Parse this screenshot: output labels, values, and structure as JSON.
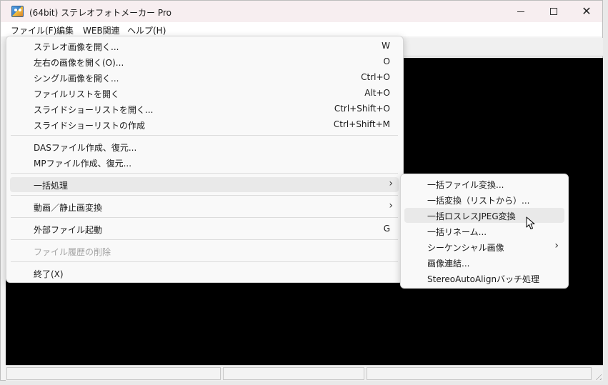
{
  "window": {
    "title": "(64bit) ステレオフォトメーカー Pro"
  },
  "menubar": {
    "items": [
      {
        "label": "ファイル(F)"
      },
      {
        "label": "編集"
      },
      {
        "label": "WEB関連"
      },
      {
        "label": "ヘルプ(H)"
      }
    ]
  },
  "file_menu": {
    "items": [
      {
        "label": "ステレオ画像を開く...",
        "shortcut": "W"
      },
      {
        "label": "左右の画像を開く(O)...",
        "shortcut": "O"
      },
      {
        "label": "シングル画像を開く...",
        "shortcut": "Ctrl+O"
      },
      {
        "label": "ファイルリストを開く",
        "shortcut": "Alt+O"
      },
      {
        "label": "スライドショーリストを開く...",
        "shortcut": "Ctrl+Shift+O"
      },
      {
        "label": "スライドショーリストの作成",
        "shortcut": "Ctrl+Shift+M"
      },
      {
        "label": "DASファイル作成、復元..."
      },
      {
        "label": "MPファイル作成、復元..."
      },
      {
        "label": "一括処理",
        "submenu": true,
        "highlighted": true
      },
      {
        "label": "動画／静止画変換",
        "submenu": true
      },
      {
        "label": "外部ファイル起動",
        "shortcut": "G"
      },
      {
        "label": "ファイル履歴の削除",
        "disabled": true
      },
      {
        "label": "終了(X)"
      }
    ]
  },
  "batch_submenu": {
    "items": [
      {
        "label": "一括ファイル変換..."
      },
      {
        "label": "一括変換（リストから）..."
      },
      {
        "label": "一括ロスレスJPEG変換",
        "highlighted": true
      },
      {
        "label": "一括リネーム..."
      },
      {
        "label": "シーケンシャル画像",
        "submenu": true
      },
      {
        "label": "画像連結..."
      },
      {
        "label": "StereoAutoAlignバッチ処理"
      }
    ]
  },
  "colors": {
    "viewer_background": "#000000",
    "titlebar_background": "#f7eef0",
    "menu_background": "#f9f9f9",
    "highlight": "#e9e9e9"
  },
  "icons": {
    "submenu_arrow": "›",
    "close": "✕"
  }
}
